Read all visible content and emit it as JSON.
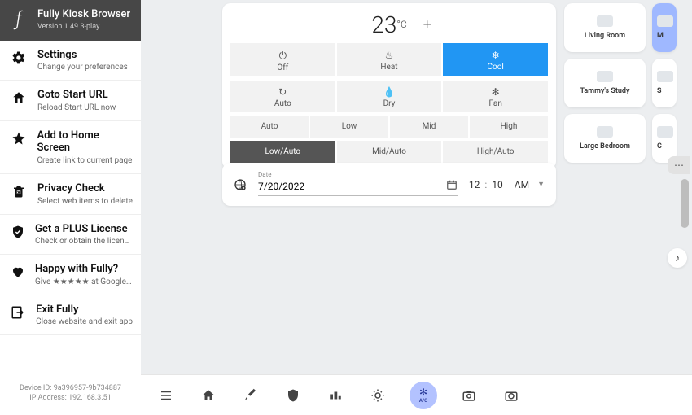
{
  "sidebar": {
    "title": "Fully Kiosk Browser",
    "version": "Version 1.49.3-play",
    "items": [
      {
        "title": "Settings",
        "sub": "Change your preferences"
      },
      {
        "title": "Goto Start URL",
        "sub": "Reload Start URL now"
      },
      {
        "title": "Add to Home Screen",
        "sub": "Create link to current page"
      },
      {
        "title": "Privacy Check",
        "sub": "Select web items to delete"
      },
      {
        "title": "Get a PLUS License",
        "sub": "Check or obtain the license"
      },
      {
        "title": "Happy with Fully?",
        "sub": "Give ★★★★★ at Google Play"
      },
      {
        "title": "Exit Fully",
        "sub": "Close website and exit app"
      }
    ],
    "device_id": "Device ID: 9a396957-9b734887",
    "ip": "IP Address: 192.168.3.51"
  },
  "ac": {
    "temp_value": "23",
    "temp_unit": "°C",
    "modes": [
      "Off",
      "Heat",
      "Cool",
      "Auto",
      "Dry",
      "Fan"
    ],
    "mode_active_index": 2,
    "fans": [
      "Auto",
      "Low",
      "Mid",
      "High"
    ],
    "sets": [
      "Low/Auto",
      "Mid/Auto",
      "High/Auto"
    ],
    "set_active_index": 0
  },
  "schedule": {
    "date_label": "Date",
    "date_value": "7/20/2022",
    "hour": "12",
    "minute": "10",
    "ampm": "AM"
  },
  "rooms": [
    {
      "name": "Living Room",
      "selected": false
    },
    {
      "name": "M",
      "selected": true,
      "partial": true
    },
    {
      "name": "Tammy's Study",
      "selected": false
    },
    {
      "name": "S",
      "selected": false,
      "partial": true
    },
    {
      "name": "Large Bedroom",
      "selected": false
    },
    {
      "name": "C",
      "selected": false,
      "partial": true
    }
  ],
  "bottombar": {
    "ac_label": "A/C"
  }
}
